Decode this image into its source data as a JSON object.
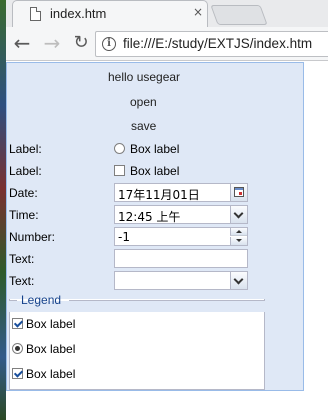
{
  "browser": {
    "tab_title": "index.htm",
    "tab_close": "×",
    "url": "file:///E:/study/EXTJS/index.htm",
    "info_glyph": "i"
  },
  "form": {
    "greeting": "hello usegear",
    "open_label": "open",
    "save_label": "save",
    "radio_row": {
      "label": "Label:",
      "box_label": "Box label",
      "checked": false
    },
    "checkbox_row": {
      "label": "Label:",
      "box_label": "Box label",
      "checked": false
    },
    "date_field": {
      "label": "Date:",
      "value": "17年11月01日"
    },
    "time_field": {
      "label": "Time:",
      "value": "12:45 上午"
    },
    "number_field": {
      "label": "Number:",
      "value": "-1"
    },
    "text_field": {
      "label": "Text:",
      "value": ""
    },
    "combo_field": {
      "label": "Text:",
      "value": ""
    },
    "fieldset": {
      "legend": "Legend",
      "items": [
        {
          "type": "checkbox",
          "label": "Box label",
          "checked": true
        },
        {
          "type": "radio",
          "label": "Box label",
          "checked": true
        },
        {
          "type": "checkbox",
          "label": "Box label",
          "checked": true
        }
      ]
    }
  },
  "colors": {
    "panel_bg": "#dfe8f6",
    "panel_border": "#99bbe8",
    "legend_text": "#15428b",
    "field_border": "#b5b8c8"
  }
}
